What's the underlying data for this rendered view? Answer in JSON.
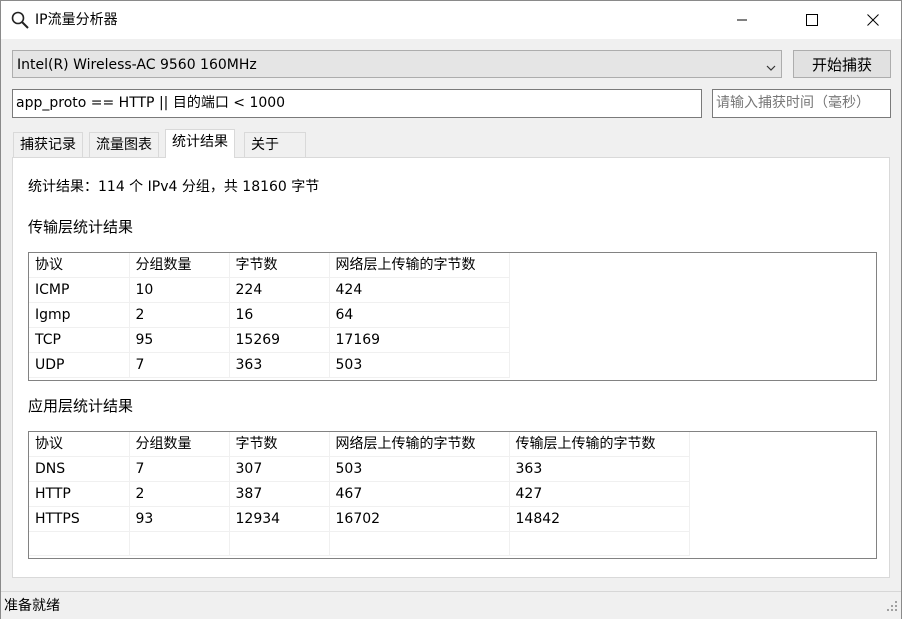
{
  "window": {
    "title": "IP流量分析器",
    "icon": "magnifier-icon"
  },
  "toolbar": {
    "adapter_selected": "Intel(R) Wireless-AC 9560 160MHz",
    "start_label": "开始捕获",
    "filter_value": "app_proto == HTTP || 目的端口 < 1000",
    "time_placeholder": "请输入捕获时间（毫秒）"
  },
  "tabs": [
    {
      "label": "捕获记录",
      "active": false
    },
    {
      "label": "流量图表",
      "active": false
    },
    {
      "label": "统计结果",
      "active": true
    },
    {
      "label": "关于",
      "active": false
    }
  ],
  "stats": {
    "summary": "统计结果：114 个 IPv4 分组，共 18160 字节",
    "transport": {
      "title": "传输层统计结果",
      "headers": [
        "协议",
        "分组数量",
        "字节数",
        "网络层上传输的字节数"
      ],
      "rows": [
        [
          "ICMP",
          "10",
          "224",
          "424"
        ],
        [
          "Igmp",
          "2",
          "16",
          "64"
        ],
        [
          "TCP",
          "95",
          "15269",
          "17169"
        ],
        [
          "UDP",
          "7",
          "363",
          "503"
        ]
      ]
    },
    "application": {
      "title": "应用层统计结果",
      "headers": [
        "协议",
        "分组数量",
        "字节数",
        "网络层上传输的字节数",
        "传输层上传输的字节数"
      ],
      "rows": [
        [
          "DNS",
          "7",
          "307",
          "503",
          "363"
        ],
        [
          "HTTP",
          "2",
          "387",
          "467",
          "427"
        ],
        [
          "HTTPS",
          "93",
          "12934",
          "16702",
          "14842"
        ]
      ]
    }
  },
  "statusbar": {
    "text": "准备就绪"
  }
}
